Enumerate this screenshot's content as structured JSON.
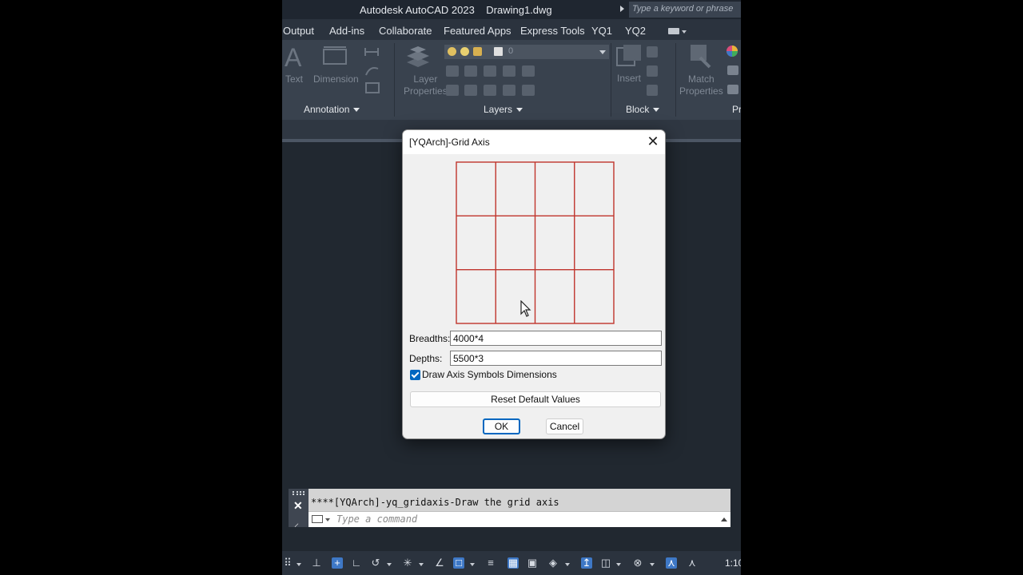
{
  "window": {
    "title": "Autodesk AutoCAD 2023    Drawing1.dwg",
    "search_placeholder": "Type a keyword or phrase"
  },
  "menu": {
    "tabs": [
      "Output",
      "Add-ins",
      "Collaborate",
      "Featured Apps",
      "Express Tools",
      "YQ1",
      "YQ2"
    ]
  },
  "ribbon": {
    "annotation": {
      "title": "Annotation",
      "text_label": "Text",
      "dimension_label": "Dimension"
    },
    "layers": {
      "title": "Layers",
      "layer_properties_label_1": "Layer",
      "layer_properties_label_2": "Properties",
      "current_layer": "0"
    },
    "block": {
      "title": "Block",
      "insert_label": "Insert"
    },
    "properties": {
      "title": "Pr",
      "match_label_1": "Match",
      "match_label_2": "Properties"
    }
  },
  "dialog": {
    "title": "[YQArch]-Grid Axis",
    "preview": {
      "columns": 4,
      "rows": 3,
      "line_color": "#c0342c"
    },
    "breadths_label": "Breadths:",
    "breadths_value": "4000*4",
    "depths_label": "Depths:",
    "depths_value": "5500*3",
    "draw_axis_symbols_label": "Draw Axis Symbols",
    "draw_axis_symbols_checked": true,
    "dimensions_label": "Dimensions",
    "reset_label": "Reset Default Values",
    "ok_label": "OK",
    "cancel_label": "Cancel"
  },
  "command_line": {
    "history": "****[YQArch]-yq_gridaxis-Draw the grid axis",
    "placeholder": "Type a command"
  },
  "status_bar": {
    "scale": "1:10"
  },
  "colors": {
    "accent": "#0067c0",
    "ribbon_bg": "#39424e",
    "canvas_bg": "#212830"
  }
}
